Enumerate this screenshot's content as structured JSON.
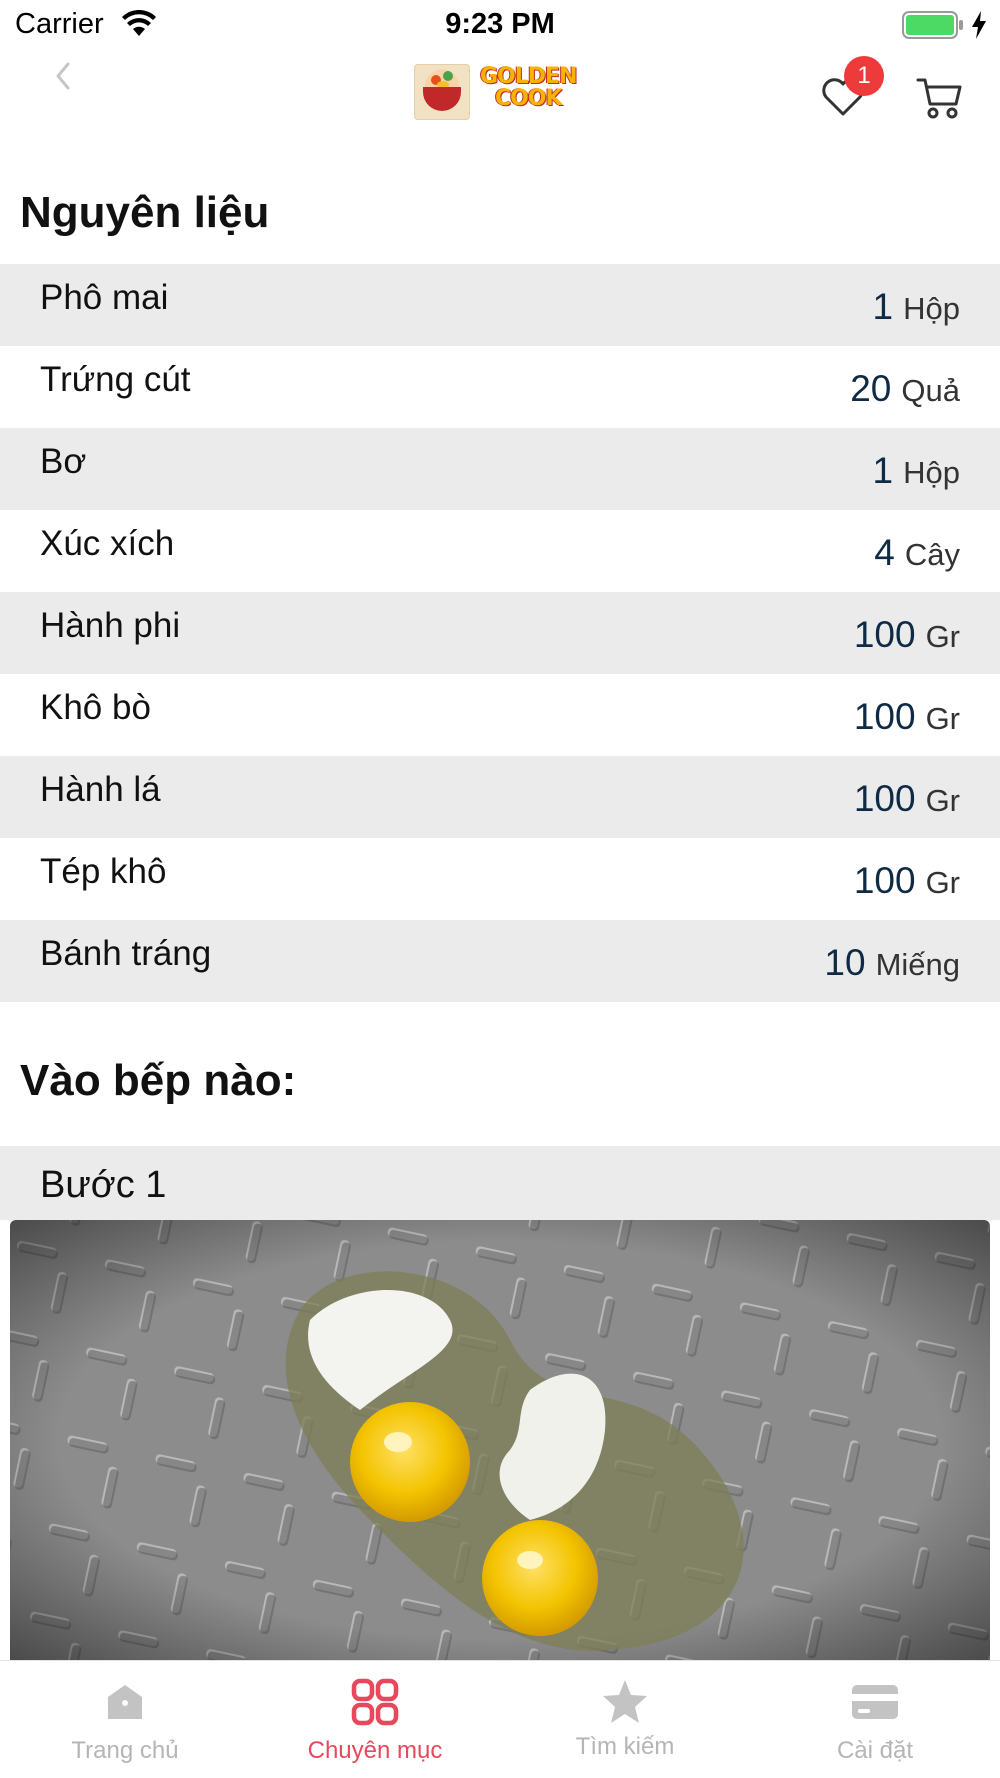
{
  "status_bar": {
    "carrier": "Carrier",
    "time": "9:23 PM"
  },
  "nav": {
    "logo_line1": "GOLDEN",
    "logo_line2": "COOK",
    "favorites_badge": "1",
    "icons": {
      "back": "chevron-left-icon",
      "favorites": "heart-icon",
      "cart": "cart-icon"
    }
  },
  "ingredients": {
    "title": "Nguyên liệu",
    "items": [
      {
        "name": "Phô mai",
        "qty": "1",
        "unit": "Hộp"
      },
      {
        "name": "Trứng cút",
        "qty": "20",
        "unit": "Quả"
      },
      {
        "name": "Bơ",
        "qty": "1",
        "unit": "Hộp"
      },
      {
        "name": "Xúc xích",
        "qty": "4",
        "unit": "Cây"
      },
      {
        "name": "Hành phi",
        "qty": "100",
        "unit": "Gr"
      },
      {
        "name": "Khô bò",
        "qty": "100",
        "unit": "Gr"
      },
      {
        "name": "Hành lá",
        "qty": "100",
        "unit": "Gr"
      },
      {
        "name": "Tép khô",
        "qty": "100",
        "unit": "Gr"
      },
      {
        "name": "Bánh tráng",
        "qty": "10",
        "unit": "Miếng"
      }
    ]
  },
  "cooking": {
    "title": "Vào bếp nào:",
    "steps": [
      {
        "label": "Bước 1",
        "image": "quail-eggs-on-pan"
      }
    ]
  },
  "tab_bar": {
    "active_index": 1,
    "tabs": [
      {
        "label": "Trang chủ",
        "icon": "home-icon"
      },
      {
        "label": "Chuyên mục",
        "icon": "grid-icon"
      },
      {
        "label": "Tìm kiếm",
        "icon": "star-icon"
      },
      {
        "label": "Cài đặt",
        "icon": "card-icon"
      }
    ]
  },
  "colors": {
    "accent": "#e8485c",
    "badge": "#ee3a3a",
    "row_shade": "#ebebeb",
    "qty_text": "#0f2a44",
    "tab_inactive": "#b5b5b5"
  }
}
